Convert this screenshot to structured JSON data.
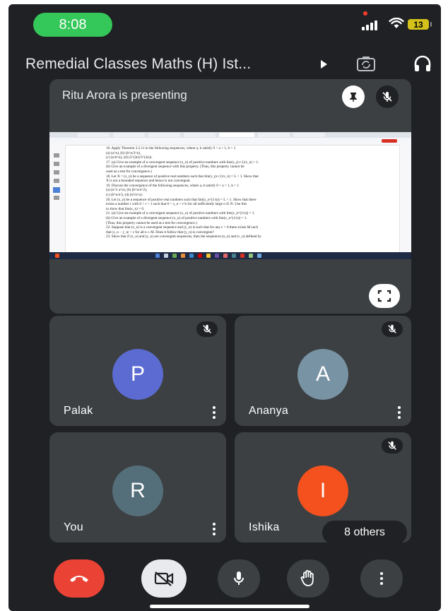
{
  "status_bar": {
    "time": "8:08",
    "battery": "13"
  },
  "header": {
    "title": "Remedial Classes Maths (H) Ist...",
    "icons": [
      "play-arrow-icon",
      "flip-camera-icon",
      "headphones-icon"
    ]
  },
  "presenter": {
    "label": "Ritu Arora is presenting",
    "icons": [
      "pin-icon",
      "mic-off-icon",
      "fullscreen-icon"
    ],
    "screen": {
      "lines": [
        "16.  Apply Theorem 3.2.11 to the following sequences, where a, b satisfy 0 < a < 1, b > 1.",
        "      (a)  (a^n),                                                  (b)  (b^n/2^n),",
        "      (c)  (n/b^n),                                                (d)  (2^(3n)/3^(2n)).",
        "17.  (a)  Give an example of a convergent sequence (x_n) of positive numbers with lim(x_(n+1)/x_n) = 1.",
        "      (b)  Give an example of a divergent sequence with this property. (Thus, this property cannot be",
        "             used as a test for convergence.)",
        "18.  Let X = (x_n) be a sequence of positive real numbers such that lim(x_(n+1)/x_n) = L > 1. Show that",
        "      X is not a bounded sequence and hence is not convergent.",
        "19.  Discuss the convergence of the following sequences, where a, b satisfy 0 < a < 1, b > 1",
        "      (a)  (n^2 a^n),                                              (b)  (b^n/n^2),",
        "      (c)  (b^n/n!),                                               (d)  (n!/n^n).",
        "20.  Let (x_n) be a sequence of positive real numbers such that lim(x_n^(1/n)) = L < 1. Show that there",
        "      exists a number r with 0 < r < 1 such that 0 < x_n < r^n for all sufficiently large n ∈ N. Use this",
        "      to show that lim(x_n) = 0.",
        "21.  (a)  Give an example of a convergent sequence (x_n) of positive numbers with lim(x_n^(1/n)) = 1.",
        "      (b)  Give an example of a divergent sequence (x_n) of positive numbers with lim(x_n^(1/n)) = 1.",
        "             (Thus, this property cannot be used as a test for convergence.)",
        "22.  Suppose that (x_n) is a convergent sequence and (y_n) is such that for any ε > 0 there exists M such",
        "      that |x_n − y_n| < ε for all n ≥ M. Does it follow that (y_n) is convergent?",
        "23.  Show that if (x_n) and (y_n) are convergent sequences, then the sequences (u_n) and (v_n) defined by"
      ]
    }
  },
  "participants": [
    {
      "name": "Palak",
      "initial": "P",
      "color": "#5b6bd1",
      "muted": true
    },
    {
      "name": "Ananya",
      "initial": "A",
      "color": "#7893a4",
      "muted": true
    },
    {
      "name": "You",
      "initial": "R",
      "color": "#546e7a",
      "muted": false
    },
    {
      "name": "Ishika",
      "initial": "I",
      "color": "#f4511e",
      "muted": true
    }
  ],
  "others": "8 others",
  "controls": [
    "end-call-button",
    "camera-off-button",
    "mic-button",
    "raise-hand-button",
    "more-options-button"
  ],
  "colors": {
    "end_call": "#ea4335",
    "tile": "#3c4043",
    "background": "#202124"
  }
}
